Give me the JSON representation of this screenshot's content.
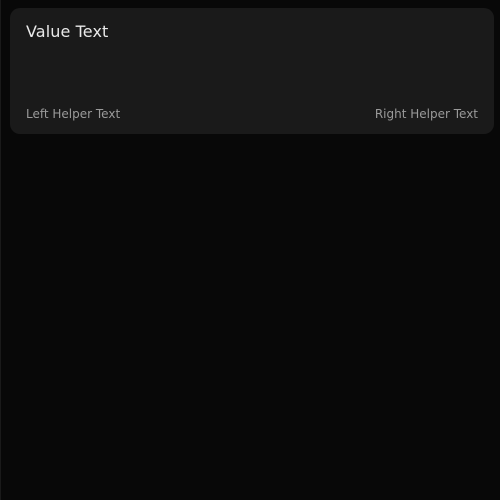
{
  "textarea": {
    "value": "Value Text",
    "left_helper": "Left Helper Text",
    "right_helper": "Right Helper Text"
  },
  "colors": {
    "background": "#080808",
    "field_background": "#1a1a1a",
    "value_text": "#e9e9e9",
    "helper_text": "#9a9a9a"
  }
}
